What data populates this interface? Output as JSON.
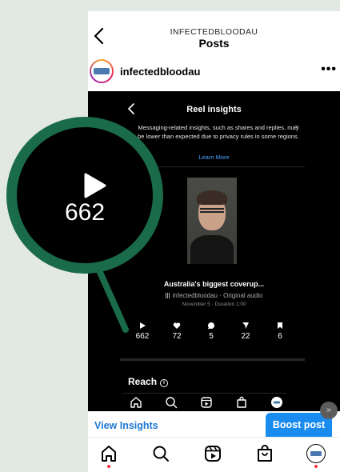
{
  "header": {
    "account": "INFECTEDBLOODAU",
    "title": "Posts"
  },
  "post": {
    "username": "infectedbloodau",
    "more_label": "•••"
  },
  "insights": {
    "title": "Reel insights",
    "notice": "Messaging-related insights, such as shares and replies, may be lower than expected due to privacy rules in some regions.",
    "notice_close": "×",
    "learn_more": "Learn More",
    "reel_title": "Australia's biggest coverup...",
    "audio": "infectedbloodau · Original audio",
    "meta": "November 5 · Duration 1:00",
    "stats": {
      "plays": "662",
      "likes": "72",
      "comments": "5",
      "shares": "22",
      "saves": "6"
    },
    "reach_label": "Reach",
    "reach_info": "i"
  },
  "actions": {
    "view_insights": "View Insights",
    "boost": "Boost post"
  },
  "zoom": {
    "value": "662"
  },
  "icons": {
    "back": "chevron-left-icon",
    "more": "more-dots-icon",
    "play": "play-icon",
    "like": "heart-icon",
    "comment": "comment-bubble-icon",
    "share": "send-icon",
    "save": "bookmark-icon",
    "home": "home-icon",
    "search": "search-icon",
    "reels": "reels-icon",
    "shop": "shopping-bag-icon",
    "profile": "avatar-icon"
  },
  "colors": {
    "accent": "#1a8cf0",
    "link": "#4ea3ff",
    "zoom_ring": "#1a6b49",
    "background": "#e2e8e2",
    "notification_dot": "#ff3040"
  }
}
